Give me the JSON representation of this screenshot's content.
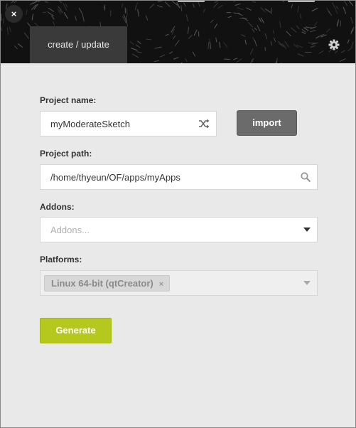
{
  "header": {
    "close_glyph": "×",
    "tab_label": "create / update",
    "settings_icon": "gear-icon"
  },
  "form": {
    "project_name": {
      "label": "Project name:",
      "value": "myModerateSketch",
      "icon": "shuffle-icon"
    },
    "import_label": "import",
    "project_path": {
      "label": "Project path:",
      "value": "/home/thyeun/OF/apps/myApps",
      "icon": "search-icon"
    },
    "addons": {
      "label": "Addons:",
      "placeholder": "Addons...",
      "icon": "dropdown-arrow-icon"
    },
    "platforms": {
      "label": "Platforms:",
      "selected": [
        "Linux 64-bit (qtCreator)"
      ],
      "remove_glyph": "×",
      "icon": "dropdown-arrow-icon"
    },
    "generate_label": "Generate"
  },
  "colors": {
    "header_bg": "#111111",
    "tab_bg": "#3a3a3a",
    "body_bg": "#e9e9e9",
    "import_button": "#6b6b6b",
    "generate_button": "#b4c81e"
  }
}
